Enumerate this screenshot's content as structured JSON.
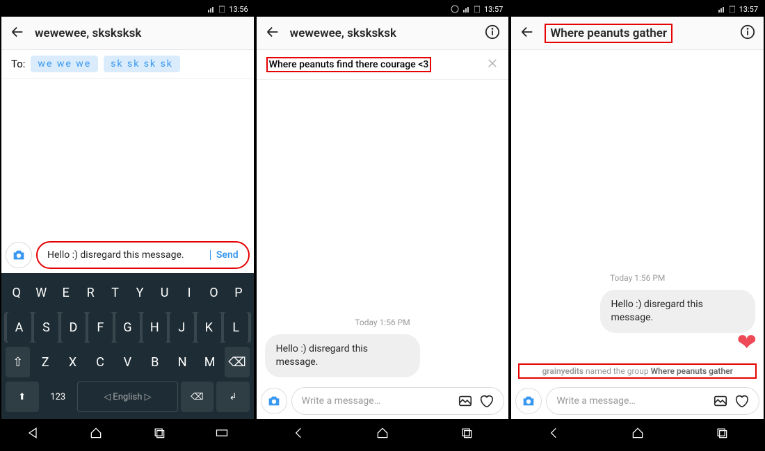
{
  "status": {
    "time1": "13:56",
    "time2": "13:57",
    "time3": "13:57"
  },
  "s1": {
    "title": "wewewee, sksksksk",
    "to_label": "To:",
    "chips": [
      "we we we",
      "sk sk sk sk"
    ],
    "typed": "Hello :) disregard this message.",
    "send": "Send",
    "keyboard": {
      "row1": [
        "Q",
        "W",
        "E",
        "R",
        "T",
        "Y",
        "U",
        "I",
        "O",
        "P"
      ],
      "row2": [
        "A",
        "S",
        "D",
        "F",
        "G",
        "H",
        "J",
        "K",
        "L"
      ],
      "row3": [
        "Z",
        "X",
        "C",
        "V",
        "B",
        "N",
        "M"
      ],
      "numkey": "123",
      "space": "◁ English ▷"
    }
  },
  "s2": {
    "title": "wewewee, sksksksk",
    "group_name_input": "Where peanuts find there courage <3",
    "timestamp": "Today 1:56 PM",
    "msg": "Hello :) disregard this message.",
    "placeholder": "Write a message…"
  },
  "s3": {
    "title": "Where peanuts gather",
    "timestamp": "Today 1:56 PM",
    "msg": "Hello :) disregard this message.",
    "sys_user": "grainyedits",
    "sys_mid": " named the group ",
    "sys_group": "Where peanuts gather",
    "placeholder": "Write a message…"
  }
}
